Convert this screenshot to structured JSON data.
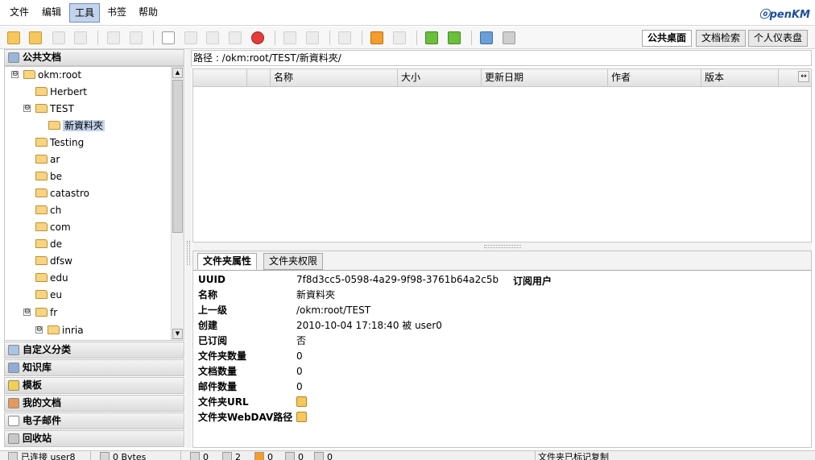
{
  "menu": {
    "items": [
      "文件",
      "编辑",
      "工具",
      "书签",
      "帮助"
    ],
    "active_index": 2
  },
  "logo": {
    "main": "penKM",
    "prefix": "ⓞ",
    "suffix": "KM"
  },
  "toolbar": {
    "tabs": [
      "公共桌面",
      "文档检索",
      "个人仪表盘"
    ],
    "active_tab": 0
  },
  "left_panel": {
    "header": "公共文档",
    "tree": [
      {
        "label": "okm:root",
        "toggle": "⊖"
      },
      {
        "label": "Herbert"
      },
      {
        "label": "TEST",
        "toggle": "⊖"
      },
      {
        "label": "新資料夾",
        "selected": true
      },
      {
        "label": "Testing"
      },
      {
        "label": "ar"
      },
      {
        "label": "be"
      },
      {
        "label": "catastro"
      },
      {
        "label": "ch"
      },
      {
        "label": "com"
      },
      {
        "label": "de"
      },
      {
        "label": "dfsw"
      },
      {
        "label": "edu"
      },
      {
        "label": "eu"
      },
      {
        "label": "fr",
        "toggle": "⊖"
      },
      {
        "label": "inria",
        "toggle": "⊖"
      }
    ],
    "sections": [
      "自定义分类",
      "知识库",
      "模板",
      "我的文档",
      "电子邮件",
      "回收站"
    ]
  },
  "path_bar": {
    "label": "路径 : /okm:root/TEST/新資料夾/"
  },
  "file_table": {
    "columns": [
      "",
      "",
      "名称",
      "大小",
      "更新日期",
      "作者",
      "版本"
    ],
    "resize_glyph": "↔"
  },
  "properties": {
    "tabs": [
      "文件夹属性",
      "文件夹权限"
    ],
    "active_tab": 0,
    "subscribers_header": "订阅用户",
    "rows": [
      {
        "key": "UUID",
        "value": "7f8d3cc5-0598-4a29-9f98-3761b64a2c5b"
      },
      {
        "key": "名称",
        "value": "新資料夾"
      },
      {
        "key": "上一级",
        "value": "/okm:root/TEST"
      },
      {
        "key": "创建",
        "value": "2010-10-04 17:18:40 被 user0"
      },
      {
        "key": "已订阅",
        "value": "否"
      },
      {
        "key": "文件夹数量",
        "value": "0"
      },
      {
        "key": "文档数量",
        "value": "0"
      },
      {
        "key": "邮件数量",
        "value": "0"
      },
      {
        "key": "文件夹URL",
        "value": ""
      },
      {
        "key": "文件夹WebDAV路径",
        "value": ""
      }
    ]
  },
  "status_bar": {
    "connected": "已连接 user8",
    "size": "0 Bytes",
    "counts": [
      "0",
      "2",
      "0",
      "0",
      "0"
    ],
    "message": "文件夹已标记复制"
  },
  "colors": {
    "selection": "#c3d3ec",
    "logo": "#1f4f9c",
    "folder": "#f7d481"
  }
}
